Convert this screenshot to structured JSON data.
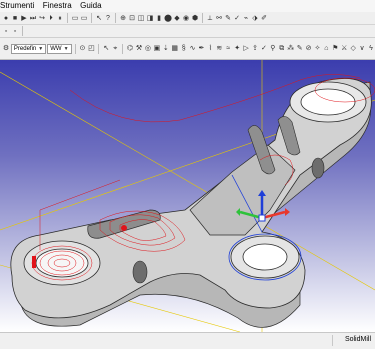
{
  "menu": {
    "items": [
      "Strumenti",
      "Finestra",
      "Guida"
    ]
  },
  "toolbar": {
    "macro_icons": [
      "record-icon",
      "stop-icon",
      "play-icon",
      "step-into-icon",
      "step-over-icon"
    ],
    "view_icons": [
      "cut-icon",
      "copy-icon",
      "paste-icon",
      "undo-icon",
      "redo-icon",
      "refresh-icon",
      "pointer-icon"
    ],
    "display_icons": [
      "fit-all-icon",
      "fit-selection-icon",
      "draw-style-icon",
      "isometric-icon",
      "front-view-icon",
      "top-view-icon",
      "right-view-icon"
    ]
  },
  "toolbar3": {
    "combo_style_value": "Predefin",
    "combo_mode_value": "WW"
  },
  "colors": {
    "viewport_top": "#3b3dae",
    "viewport_bottom": "#ffffff",
    "toolpath": "#e0141a",
    "axis_x": "#e8372c",
    "axis_y": "#2ec23a",
    "axis_z": "#1f3fd8",
    "construction_yellow": "#e6c800"
  },
  "statusbar": {
    "brand": "SolidMill"
  }
}
